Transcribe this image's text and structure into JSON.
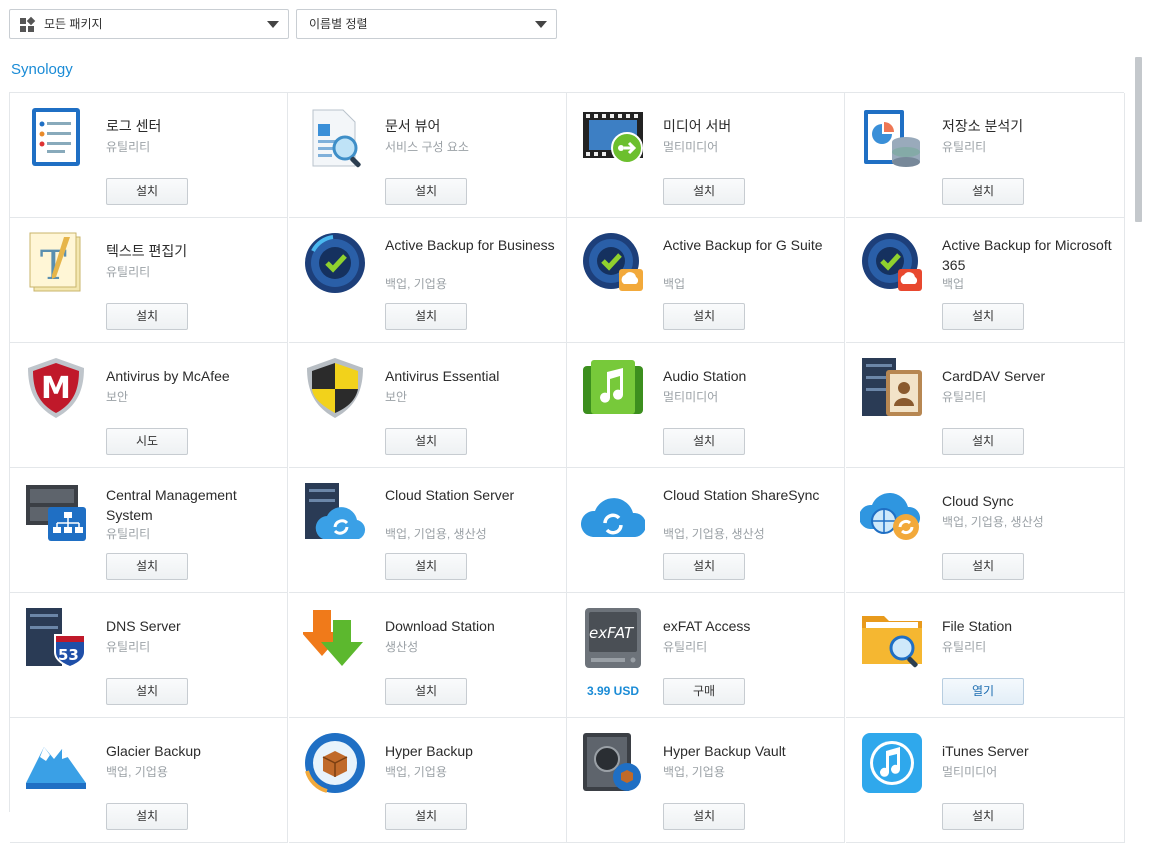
{
  "filters": {
    "category_select": "모든 패키지",
    "sort_select": "이름별 정렬"
  },
  "section_title": "Synology",
  "packages": [
    {
      "name": "로그 센터",
      "category": "유틸리티",
      "action": "설치",
      "icon": "log-center-icon"
    },
    {
      "name": "문서 뷰어",
      "category": "서비스 구성 요소",
      "action": "설치",
      "icon": "document-viewer-icon"
    },
    {
      "name": "미디어 서버",
      "category": "멀티미디어",
      "action": "설치",
      "icon": "media-server-icon"
    },
    {
      "name": "저장소 분석기",
      "category": "유틸리티",
      "action": "설치",
      "icon": "storage-analyzer-icon"
    },
    {
      "name": "텍스트 편집기",
      "category": "유틸리티",
      "action": "설치",
      "icon": "text-editor-icon"
    },
    {
      "name": "Active Backup for Business",
      "category": "백업, 기업용",
      "action": "설치",
      "icon": "active-backup-business-icon"
    },
    {
      "name": "Active Backup for G Suite",
      "category": "백업",
      "action": "설치",
      "icon": "active-backup-gsuite-icon"
    },
    {
      "name": "Active Backup for Microsoft 365",
      "category": "백업",
      "action": "설치",
      "icon": "active-backup-m365-icon"
    },
    {
      "name": "Antivirus by McAfee",
      "category": "보안",
      "action": "시도",
      "icon": "mcafee-shield-icon"
    },
    {
      "name": "Antivirus Essential",
      "category": "보안",
      "action": "설치",
      "icon": "antivirus-shield-icon"
    },
    {
      "name": "Audio Station",
      "category": "멀티미디어",
      "action": "설치",
      "icon": "audio-station-icon"
    },
    {
      "name": "CardDAV Server",
      "category": "유틸리티",
      "action": "설치",
      "icon": "carddav-icon"
    },
    {
      "name": "Central Management System",
      "category": "유틸리티",
      "action": "설치",
      "icon": "cms-icon"
    },
    {
      "name": "Cloud Station Server",
      "category": "백업, 기업용, 생산성",
      "action": "설치",
      "icon": "cloud-station-server-icon"
    },
    {
      "name": "Cloud Station ShareSync",
      "category": "백업, 기업용, 생산성",
      "action": "설치",
      "icon": "cloud-sharesync-icon"
    },
    {
      "name": "Cloud Sync",
      "category": "백업, 기업용, 생산성",
      "action": "설치",
      "icon": "cloud-sync-icon"
    },
    {
      "name": "DNS Server",
      "category": "유틸리티",
      "action": "설치",
      "icon": "dns-server-icon"
    },
    {
      "name": "Download Station",
      "category": "생산성",
      "action": "설치",
      "icon": "download-station-icon"
    },
    {
      "name": "exFAT Access",
      "category": "유틸리티",
      "action": "구매",
      "price": "3.99 USD",
      "icon": "exfat-drive-icon"
    },
    {
      "name": "File Station",
      "category": "유틸리티",
      "action": "열기",
      "icon": "file-station-icon"
    },
    {
      "name": "Glacier Backup",
      "category": "백업, 기업용",
      "action": "설치",
      "icon": "glacier-icon"
    },
    {
      "name": "Hyper Backup",
      "category": "백업, 기업용",
      "action": "설치",
      "icon": "hyper-backup-icon"
    },
    {
      "name": "Hyper Backup Vault",
      "category": "백업, 기업용",
      "action": "설치",
      "icon": "hyper-backup-vault-icon"
    },
    {
      "name": "iTunes Server",
      "category": "멀티미디어",
      "action": "설치",
      "icon": "itunes-server-icon"
    }
  ],
  "icon_text": {
    "exfat": "exFAT",
    "dns": "53"
  },
  "colors": {
    "accent": "#1a8bd6",
    "border": "#e4e7ea"
  }
}
